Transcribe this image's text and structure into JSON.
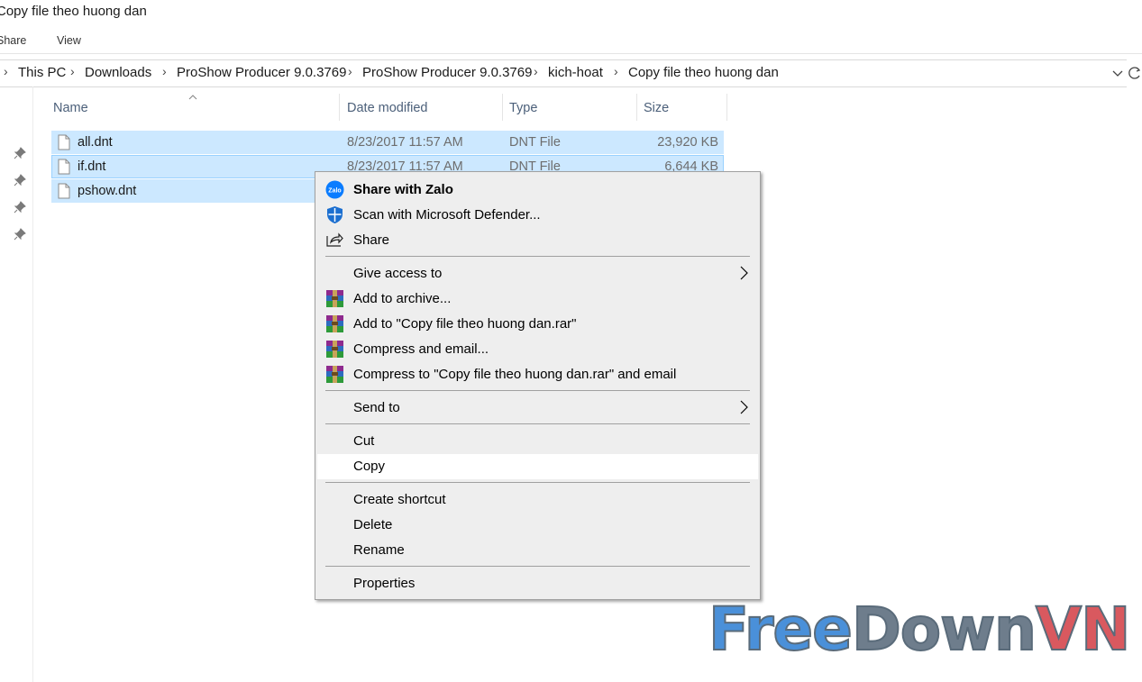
{
  "window": {
    "title": "Copy file theo huong dan"
  },
  "ribbon": {
    "tabs": [
      "Share",
      "View"
    ]
  },
  "address_bar": {
    "crumbs": [
      "This PC",
      "Downloads",
      "ProShow Producer 9.0.3769",
      "ProShow Producer 9.0.3769",
      "kich-hoat",
      "Copy file theo huong dan"
    ]
  },
  "columns": {
    "name": "Name",
    "date": "Date modified",
    "type": "Type",
    "size": "Size"
  },
  "files": [
    {
      "name": "all.dnt",
      "date": "8/23/2017 11:57 AM",
      "type": "DNT File",
      "size": "23,920 KB"
    },
    {
      "name": "if.dnt",
      "date": "8/23/2017 11:57 AM",
      "type": "DNT File",
      "size": "6,644 KB"
    },
    {
      "name": "pshow.dnt",
      "date": "",
      "type": "",
      "size": ""
    }
  ],
  "context_menu": {
    "share_with_zalo": "Share with Zalo",
    "scan_defender": "Scan with Microsoft Defender...",
    "share": "Share",
    "give_access": "Give access to",
    "add_archive": "Add to archive...",
    "add_rar": "Add to \"Copy file theo huong dan.rar\"",
    "compress_email": "Compress and email...",
    "compress_rar_email": "Compress to \"Copy file theo huong dan.rar\" and email",
    "send_to": "Send to",
    "cut": "Cut",
    "copy": "Copy",
    "create_shortcut": "Create shortcut",
    "delete": "Delete",
    "rename": "Rename",
    "properties": "Properties",
    "zalo_icon_text": "Zalo"
  },
  "watermark": {
    "part1": "Free",
    "part2": "Down",
    "part3": "VN"
  },
  "colors": {
    "selection": "#cce8ff",
    "hover": "#ffffff",
    "menu_bg": "#eeeeee",
    "watermark_blue": "#4a90d9",
    "watermark_gray": "#6e7d8c",
    "watermark_red": "#d9595f"
  },
  "icons": {
    "zalo": "zalo-icon",
    "defender": "shield-icon",
    "share": "share-icon",
    "winrar": "winrar-icon",
    "submenu": "chevron-right-icon",
    "pin": "pin-icon",
    "file": "file-icon"
  }
}
